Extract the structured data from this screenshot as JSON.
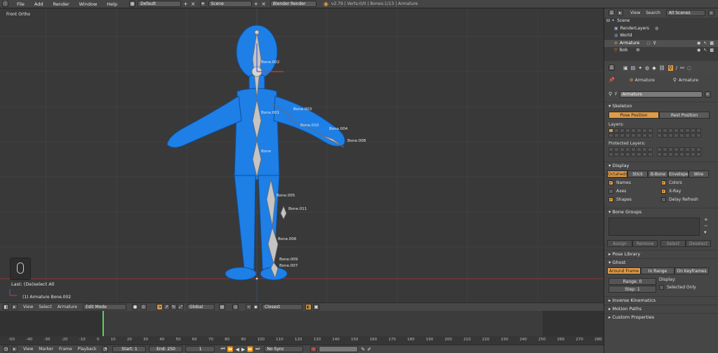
{
  "topbar": {
    "menus": [
      "File",
      "Add",
      "Render",
      "Window",
      "Help"
    ],
    "screen_layout": "Default",
    "scene": "Scene",
    "render_engine": "Blender Render",
    "stats": "v2.79 | Verts:0/0 | Bones:1/13 | Armature"
  },
  "viewport": {
    "view_label": "Front Ortho",
    "last_op": "Last: (De)select All",
    "selection_info": "(1) Armature Bone.002",
    "bones": [
      "Bone.002",
      "Bone.003",
      "Bone.001",
      "Bone.010",
      "Bone.004",
      "Bone.008",
      "Bone",
      "Bone.005",
      "Bone.011",
      "Bone.006",
      "Bone.009",
      "Bone.007"
    ]
  },
  "vp_header": {
    "menus": [
      "View",
      "Select",
      "Armature"
    ],
    "mode": "Edit Mode",
    "orientation": "Global",
    "snap": "Closest"
  },
  "timeline": {
    "ruler": [
      "-50",
      "-40",
      "-30",
      "-20",
      "-10",
      "0",
      "10",
      "20",
      "30",
      "40",
      "50",
      "60",
      "70",
      "80",
      "90",
      "100",
      "110",
      "120",
      "130",
      "140",
      "150",
      "160",
      "170",
      "180",
      "190",
      "200",
      "210",
      "220",
      "230",
      "240",
      "250",
      "260",
      "270",
      "280"
    ],
    "menus": [
      "View",
      "Marker",
      "Frame",
      "Playback"
    ],
    "start": "Start: 1",
    "end": "End: 250",
    "current": "1",
    "sync": "No Sync"
  },
  "outliner": {
    "menus": [
      "View",
      "Search"
    ],
    "filter": "All Scenes",
    "rows": [
      "Scene",
      "RenderLayers",
      "World",
      "Armature",
      "Bob"
    ]
  },
  "properties": {
    "context_items": [
      "Armature",
      "Armature"
    ],
    "data_name": "Armature",
    "skeleton": {
      "title": "Skeleton",
      "pose_btn": "Pose Position",
      "rest_btn": "Rest Position",
      "layers_label": "Layers:",
      "protected_label": "Protected Layers:"
    },
    "display": {
      "title": "Display",
      "modes": [
        "Octahedral",
        "Stick",
        "B-Bone",
        "Envelope",
        "Wire"
      ],
      "checks_left": [
        "Names",
        "Axes",
        "Shapes"
      ],
      "checks_right": [
        "Colors",
        "X-Ray",
        "Delay Refresh"
      ]
    },
    "bone_groups": {
      "title": "Bone Groups",
      "buttons": [
        "Assign",
        "Remove",
        "Select",
        "Deselect"
      ]
    },
    "pose_library": "Pose Library",
    "ghost": {
      "title": "Ghost",
      "modes": [
        "Around Frame",
        "In Range",
        "On Keyframes"
      ],
      "range": "Range: 0",
      "step": "Step: 1",
      "display_label": "Display:",
      "selected_only": "Selected Only"
    },
    "collapsed": [
      "Inverse Kinematics",
      "Motion Paths",
      "Custom Properties"
    ]
  },
  "colors": {
    "accent": "#e29b45",
    "mesh": "#1f7fe0",
    "bone": "#bdbdbd"
  }
}
